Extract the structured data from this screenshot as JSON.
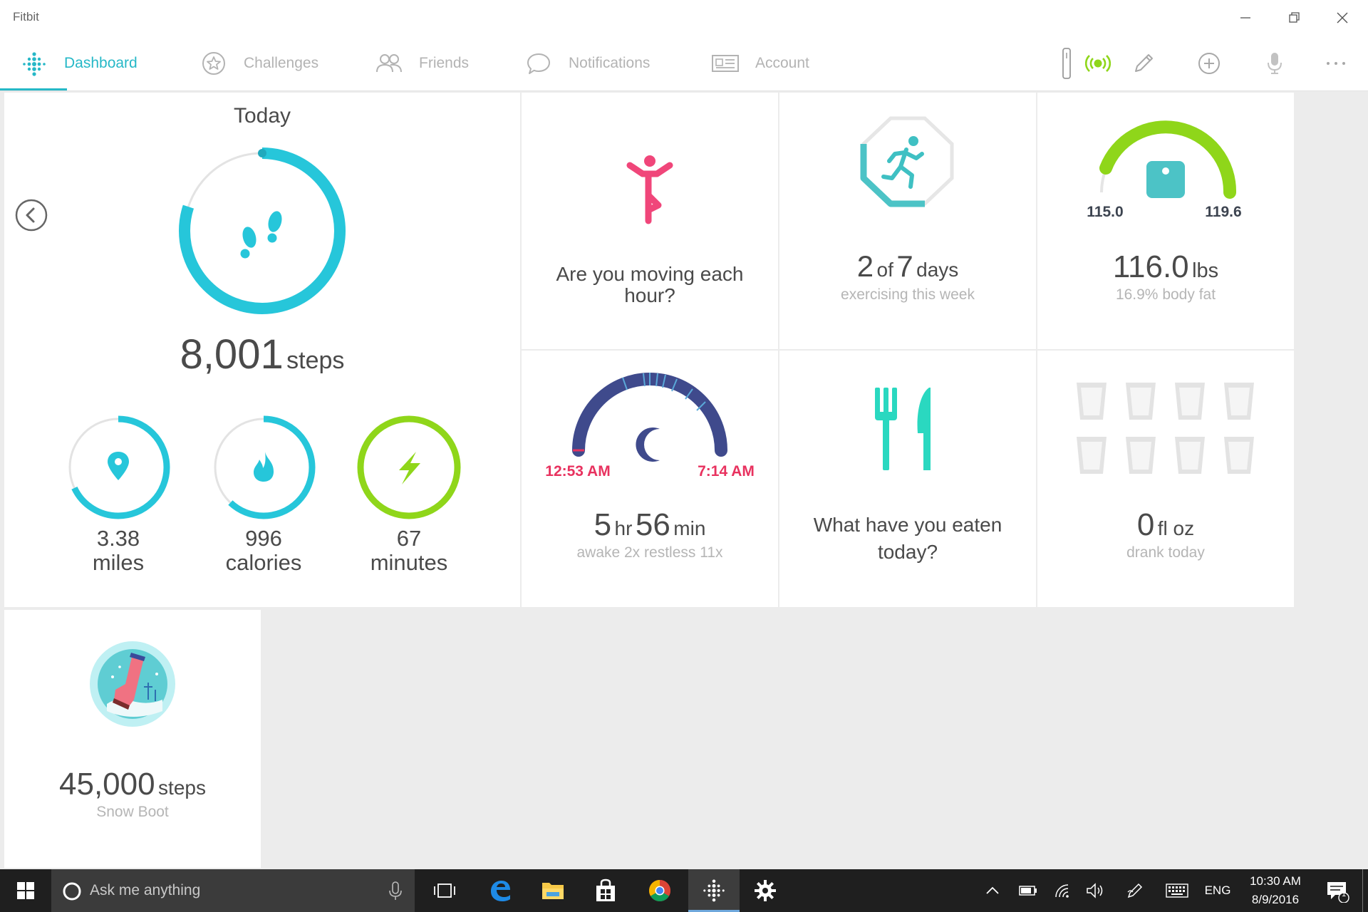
{
  "window": {
    "title": "Fitbit"
  },
  "nav": {
    "tabs": [
      {
        "label": "Dashboard",
        "icon": "fitbit-dots-icon",
        "active": true
      },
      {
        "label": "Challenges",
        "icon": "star-badge-icon",
        "active": false
      },
      {
        "label": "Friends",
        "icon": "friends-icon",
        "active": false
      },
      {
        "label": "Notifications",
        "icon": "speech-bubble-icon",
        "active": false
      },
      {
        "label": "Account",
        "icon": "id-card-icon",
        "active": false
      }
    ],
    "tools": [
      "tracker-icon",
      "sync-icon",
      "pencil-icon",
      "add-icon",
      "microphone-icon",
      "more-icon"
    ]
  },
  "today": {
    "title": "Today",
    "steps_value": "8,001",
    "steps_unit": "steps",
    "steps_progress": 0.8,
    "stats": [
      {
        "value": "3.38",
        "label": "miles",
        "progress": 0.68,
        "color": "#26c6da",
        "icon": "location-pin-icon"
      },
      {
        "value": "996",
        "label": "calories",
        "progress": 0.62,
        "color": "#26c6da",
        "icon": "flame-icon"
      },
      {
        "value": "67",
        "label": "minutes",
        "progress": 1.0,
        "color": "#8fd61a",
        "icon": "lightning-icon"
      }
    ]
  },
  "hourly": {
    "question": "Are you moving each hour?"
  },
  "exercise": {
    "count": "2",
    "of": "of",
    "goal": "7",
    "unit": "days",
    "caption": "exercising this week",
    "progress": 0.2857
  },
  "weight": {
    "min": "115.0",
    "max": "119.6",
    "value": "116.0",
    "unit": "lbs",
    "caption": "16.9% body fat"
  },
  "sleep": {
    "start": "12:53 AM",
    "end": "7:14 AM",
    "hours": "5",
    "hr_unit": "hr",
    "minutes": "56",
    "min_unit": "min",
    "caption": "awake 2x restless 11x"
  },
  "food": {
    "question": "What have you eaten today?"
  },
  "water": {
    "value": "0",
    "unit": "fl oz",
    "caption": "drank today",
    "glasses": 8
  },
  "badge": {
    "value": "45,000",
    "unit": "steps",
    "name": "Snow Boot"
  },
  "colors": {
    "accent": "#26b8c7",
    "steps_ring": "#26c6da",
    "active_green": "#8fd61a",
    "hourly_pink": "#f0467a",
    "sleep_navy": "#3f4a8c",
    "sleep_label": "#e8325f",
    "food_teal": "#2ad8c0",
    "scale_teal": "#4cc3c6"
  },
  "taskbar": {
    "search_placeholder": "Ask me anything",
    "language": "ENG",
    "time": "10:30 AM",
    "date": "8/9/2016",
    "notification_count": "1"
  }
}
